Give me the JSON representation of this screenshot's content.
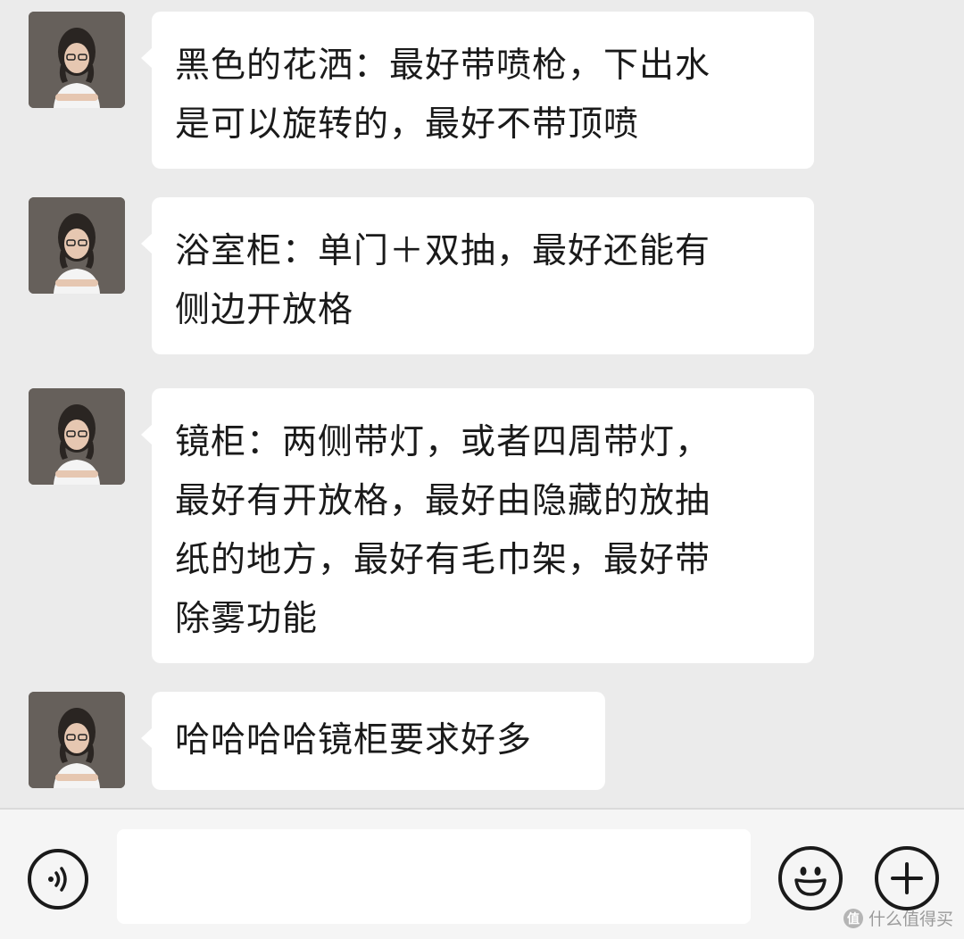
{
  "messages": [
    {
      "avatar": "avatar-icon",
      "text": "黑色的花洒：最好带喷枪，下出水\n是可以旋转的，最好不带顶喷"
    },
    {
      "avatar": "avatar-icon",
      "text": "浴室柜：单门＋双抽，最好还能有\n侧边开放格"
    },
    {
      "avatar": "avatar-icon",
      "text": "镜柜：两侧带灯，或者四周带灯，\n最好有开放格，最好由隐藏的放抽\n纸的地方，最好有毛巾架，最好带\n除雾功能"
    },
    {
      "avatar": "avatar-icon",
      "text": "哈哈哈哈镜柜要求好多"
    }
  ],
  "input_bar": {
    "voice_icon": "voice-icon",
    "input_value": "",
    "emoji_icon": "smiley-icon",
    "more_icon": "plus-icon"
  },
  "watermark": {
    "badge": "值",
    "text": "什么值得买"
  },
  "colors": {
    "chat_background": "#ebebeb",
    "bubble": "#ffffff",
    "input_bar": "#f5f5f5",
    "text": "#1a1a1a"
  }
}
